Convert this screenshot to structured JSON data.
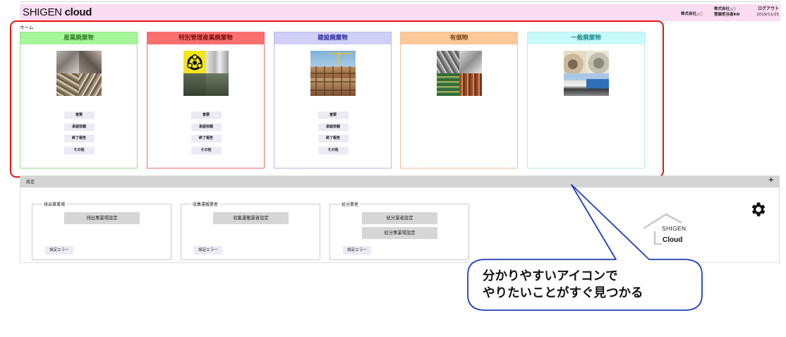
{
  "header": {
    "logo_prefix": "SHIGEN ",
    "logo_suffix": "cloud",
    "company": "株式会社△○",
    "user_line1": "株式会社△○",
    "user_line2": "登録担当者KN",
    "logout": "ログアウト",
    "date": "2019/11/25"
  },
  "home_label": "ホーム",
  "categories": [
    {
      "title": "産業廃棄物",
      "buttons": [
        "査要",
        "承認依頼",
        "終了報告",
        "その他"
      ]
    },
    {
      "title": "特別管理産業廃棄物",
      "buttons": [
        "査要",
        "承認依頼",
        "終了報告",
        "その他"
      ]
    },
    {
      "title": "建設廃棄物",
      "buttons": [
        "査要",
        "承認依頼",
        "終了報告",
        "その他"
      ]
    },
    {
      "title": "有価物",
      "buttons": []
    },
    {
      "title": "一般廃棄物",
      "buttons": []
    }
  ],
  "colors": {
    "header_bg": "#fbdcf2",
    "highlight": "#e01616",
    "callout": "#1f3fb8",
    "card_themes": [
      {
        "head": "#a6f59a",
        "border": "#8fe57f",
        "text": "#2f7f24"
      },
      {
        "head": "#fb6f6f",
        "border": "#f36c6c",
        "text": "#7a0c0c"
      },
      {
        "head": "#cfcff8",
        "border": "#b8b8ee",
        "text": "#2a2a9a"
      },
      {
        "head": "#fcc89a",
        "border": "#f5c296",
        "text": "#7a4410"
      },
      {
        "head": "#c9fafa",
        "border": "#b4f0ef",
        "text": "#1a8a8a"
      }
    ]
  },
  "settings": {
    "label": "設定",
    "toggle": "+",
    "groups": [
      {
        "label": "排出事業場",
        "buttons": [
          "排出事業場設定"
        ],
        "error": "設定エラー"
      },
      {
        "label": "収集運搬業者",
        "buttons": [
          "収集運搬業者設定"
        ],
        "error": "設定エラー"
      },
      {
        "label": "処分業者",
        "buttons": [
          "処分業者設定",
          "処分事業場設定"
        ],
        "error": "設定エラー"
      }
    ]
  },
  "brand": {
    "line1": "SHIGEN",
    "line2": "Cloud"
  },
  "callout": {
    "line1": "分かりやすいアイコンで",
    "line2": "やりたいことがすぐ見つかる"
  }
}
